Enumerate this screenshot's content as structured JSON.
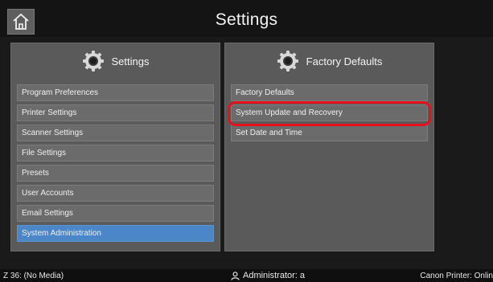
{
  "header": {
    "title": "Settings",
    "home_icon": "home-icon"
  },
  "panels": {
    "left": {
      "title": "Settings",
      "icon": "gear-icon",
      "items": [
        {
          "label": "Program Preferences",
          "selected": false
        },
        {
          "label": "Printer Settings",
          "selected": false
        },
        {
          "label": "Scanner Settings",
          "selected": false
        },
        {
          "label": "File Settings",
          "selected": false
        },
        {
          "label": "Presets",
          "selected": false
        },
        {
          "label": "User Accounts",
          "selected": false
        },
        {
          "label": "Email Settings",
          "selected": false
        },
        {
          "label": "System Administration",
          "selected": true
        }
      ]
    },
    "right": {
      "title": "Factory Defaults",
      "icon": "gear-icon",
      "items": [
        {
          "label": "Factory Defaults",
          "highlighted": false
        },
        {
          "label": "System Update and Recovery",
          "highlighted": true
        },
        {
          "label": "Set Date and Time",
          "highlighted": false
        }
      ]
    }
  },
  "status": {
    "left": "Z 36: (No Media)",
    "user": "Administrator: a",
    "right": "Canon Printer: Onlin"
  },
  "colors": {
    "selected": "#4a86c8",
    "highlight_ring": "#e8101a",
    "panel_bg": "#5a5a5a"
  }
}
